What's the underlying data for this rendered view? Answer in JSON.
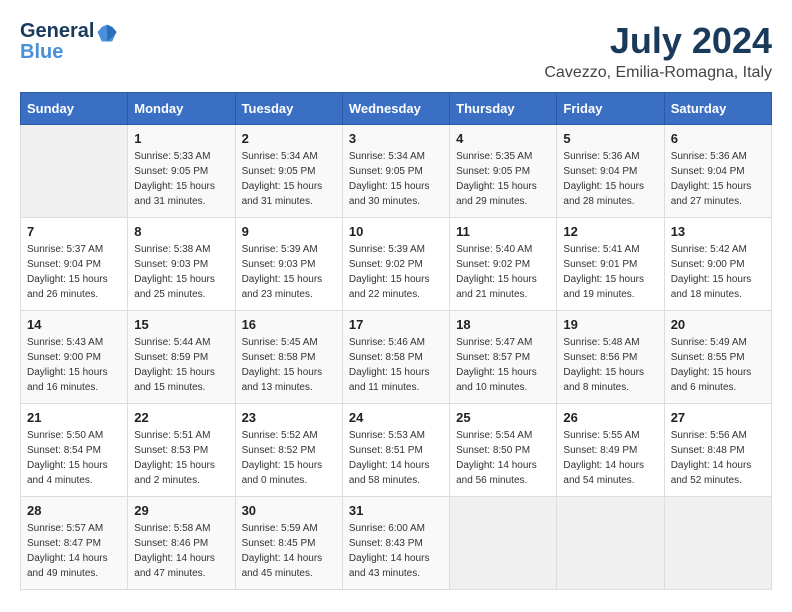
{
  "header": {
    "logo_line1": "General",
    "logo_line2": "Blue",
    "month_year": "July 2024",
    "location": "Cavezzo, Emilia-Romagna, Italy"
  },
  "weekdays": [
    "Sunday",
    "Monday",
    "Tuesday",
    "Wednesday",
    "Thursday",
    "Friday",
    "Saturday"
  ],
  "weeks": [
    [
      {
        "day": "",
        "info": ""
      },
      {
        "day": "1",
        "info": "Sunrise: 5:33 AM\nSunset: 9:05 PM\nDaylight: 15 hours\nand 31 minutes."
      },
      {
        "day": "2",
        "info": "Sunrise: 5:34 AM\nSunset: 9:05 PM\nDaylight: 15 hours\nand 31 minutes."
      },
      {
        "day": "3",
        "info": "Sunrise: 5:34 AM\nSunset: 9:05 PM\nDaylight: 15 hours\nand 30 minutes."
      },
      {
        "day": "4",
        "info": "Sunrise: 5:35 AM\nSunset: 9:05 PM\nDaylight: 15 hours\nand 29 minutes."
      },
      {
        "day": "5",
        "info": "Sunrise: 5:36 AM\nSunset: 9:04 PM\nDaylight: 15 hours\nand 28 minutes."
      },
      {
        "day": "6",
        "info": "Sunrise: 5:36 AM\nSunset: 9:04 PM\nDaylight: 15 hours\nand 27 minutes."
      }
    ],
    [
      {
        "day": "7",
        "info": "Sunrise: 5:37 AM\nSunset: 9:04 PM\nDaylight: 15 hours\nand 26 minutes."
      },
      {
        "day": "8",
        "info": "Sunrise: 5:38 AM\nSunset: 9:03 PM\nDaylight: 15 hours\nand 25 minutes."
      },
      {
        "day": "9",
        "info": "Sunrise: 5:39 AM\nSunset: 9:03 PM\nDaylight: 15 hours\nand 23 minutes."
      },
      {
        "day": "10",
        "info": "Sunrise: 5:39 AM\nSunset: 9:02 PM\nDaylight: 15 hours\nand 22 minutes."
      },
      {
        "day": "11",
        "info": "Sunrise: 5:40 AM\nSunset: 9:02 PM\nDaylight: 15 hours\nand 21 minutes."
      },
      {
        "day": "12",
        "info": "Sunrise: 5:41 AM\nSunset: 9:01 PM\nDaylight: 15 hours\nand 19 minutes."
      },
      {
        "day": "13",
        "info": "Sunrise: 5:42 AM\nSunset: 9:00 PM\nDaylight: 15 hours\nand 18 minutes."
      }
    ],
    [
      {
        "day": "14",
        "info": "Sunrise: 5:43 AM\nSunset: 9:00 PM\nDaylight: 15 hours\nand 16 minutes."
      },
      {
        "day": "15",
        "info": "Sunrise: 5:44 AM\nSunset: 8:59 PM\nDaylight: 15 hours\nand 15 minutes."
      },
      {
        "day": "16",
        "info": "Sunrise: 5:45 AM\nSunset: 8:58 PM\nDaylight: 15 hours\nand 13 minutes."
      },
      {
        "day": "17",
        "info": "Sunrise: 5:46 AM\nSunset: 8:58 PM\nDaylight: 15 hours\nand 11 minutes."
      },
      {
        "day": "18",
        "info": "Sunrise: 5:47 AM\nSunset: 8:57 PM\nDaylight: 15 hours\nand 10 minutes."
      },
      {
        "day": "19",
        "info": "Sunrise: 5:48 AM\nSunset: 8:56 PM\nDaylight: 15 hours\nand 8 minutes."
      },
      {
        "day": "20",
        "info": "Sunrise: 5:49 AM\nSunset: 8:55 PM\nDaylight: 15 hours\nand 6 minutes."
      }
    ],
    [
      {
        "day": "21",
        "info": "Sunrise: 5:50 AM\nSunset: 8:54 PM\nDaylight: 15 hours\nand 4 minutes."
      },
      {
        "day": "22",
        "info": "Sunrise: 5:51 AM\nSunset: 8:53 PM\nDaylight: 15 hours\nand 2 minutes."
      },
      {
        "day": "23",
        "info": "Sunrise: 5:52 AM\nSunset: 8:52 PM\nDaylight: 15 hours\nand 0 minutes."
      },
      {
        "day": "24",
        "info": "Sunrise: 5:53 AM\nSunset: 8:51 PM\nDaylight: 14 hours\nand 58 minutes."
      },
      {
        "day": "25",
        "info": "Sunrise: 5:54 AM\nSunset: 8:50 PM\nDaylight: 14 hours\nand 56 minutes."
      },
      {
        "day": "26",
        "info": "Sunrise: 5:55 AM\nSunset: 8:49 PM\nDaylight: 14 hours\nand 54 minutes."
      },
      {
        "day": "27",
        "info": "Sunrise: 5:56 AM\nSunset: 8:48 PM\nDaylight: 14 hours\nand 52 minutes."
      }
    ],
    [
      {
        "day": "28",
        "info": "Sunrise: 5:57 AM\nSunset: 8:47 PM\nDaylight: 14 hours\nand 49 minutes."
      },
      {
        "day": "29",
        "info": "Sunrise: 5:58 AM\nSunset: 8:46 PM\nDaylight: 14 hours\nand 47 minutes."
      },
      {
        "day": "30",
        "info": "Sunrise: 5:59 AM\nSunset: 8:45 PM\nDaylight: 14 hours\nand 45 minutes."
      },
      {
        "day": "31",
        "info": "Sunrise: 6:00 AM\nSunset: 8:43 PM\nDaylight: 14 hours\nand 43 minutes."
      },
      {
        "day": "",
        "info": ""
      },
      {
        "day": "",
        "info": ""
      },
      {
        "day": "",
        "info": ""
      }
    ]
  ]
}
